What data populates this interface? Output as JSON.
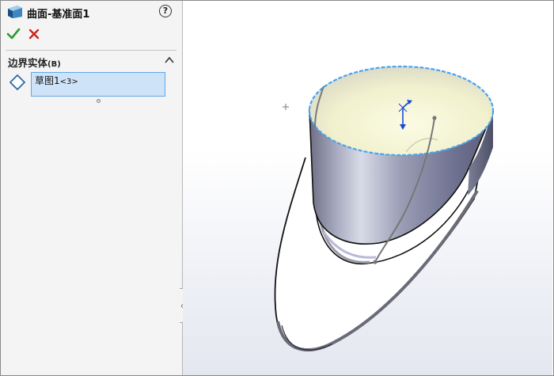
{
  "property_manager": {
    "title": "曲面-基准面1",
    "help_label": "?",
    "actions": {
      "ok_icon": "checkmark-icon",
      "cancel_icon": "close-icon",
      "ok_color": "#2e9b2e",
      "cancel_color": "#d42020"
    },
    "section": {
      "title": "边界实体",
      "accelerator": "(B)",
      "items": [
        {
          "label": "草图1",
          "suffix": "<3>"
        }
      ]
    }
  },
  "viewport": {
    "icons": [
      "origin-plus-icon",
      "triad-axis-icon"
    ],
    "colors": {
      "selection_edge": "#4aa3f0",
      "surface_inner": "#f3f3cf",
      "wall": "#8a8da8",
      "triad": "#1a4ad8"
    }
  }
}
